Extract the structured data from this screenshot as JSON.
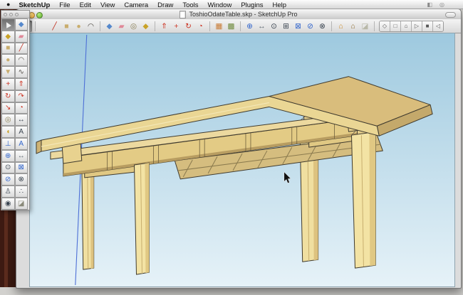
{
  "menubar": {
    "apple_icon": "●",
    "items": [
      "SketchUp",
      "File",
      "Edit",
      "View",
      "Camera",
      "Draw",
      "Tools",
      "Window",
      "Plugins",
      "Help"
    ],
    "extras": [
      {
        "name": "menu-extra-display-icon",
        "glyph": "◧"
      },
      {
        "name": "menu-extra-volume-icon",
        "glyph": "◎"
      }
    ]
  },
  "window": {
    "title": "ToshioOdateTable.skp - SketchUp Pro"
  },
  "toolbar": {
    "groups": [
      [
        {
          "name": "select-tool",
          "glyph": "▶",
          "color": "#1a1a1a",
          "active": true,
          "rotate": true
        }
      ],
      [
        {
          "name": "line-tool",
          "glyph": "╱",
          "color": "#c03020"
        },
        {
          "name": "rectangle-tool",
          "glyph": "■",
          "color": "#c9ad6d"
        },
        {
          "name": "circle-tool",
          "glyph": "●",
          "color": "#c9ad6d"
        },
        {
          "name": "arc-tool",
          "glyph": "◠",
          "color": "#55504a"
        }
      ],
      [
        {
          "name": "make-component-tool",
          "glyph": "◆",
          "color": "#5588cc"
        },
        {
          "name": "eraser-tool",
          "glyph": "▰",
          "color": "#e08898"
        },
        {
          "name": "tape-measure-tool",
          "glyph": "◎",
          "color": "#8a7f55"
        },
        {
          "name": "paint-bucket-tool",
          "glyph": "◆",
          "color": "#c9a227"
        }
      ],
      [
        {
          "name": "push-pull-tool",
          "glyph": "⇑",
          "color": "#cc3322"
        },
        {
          "name": "move-tool",
          "glyph": "+",
          "color": "#cc3322"
        },
        {
          "name": "rotate-tool",
          "glyph": "↻",
          "color": "#cc3322"
        },
        {
          "name": "offset-tool",
          "glyph": "◔",
          "color": "#cc3322"
        }
      ],
      [
        {
          "name": "toggle-terrain-button",
          "glyph": "▦",
          "color": "#c87830"
        },
        {
          "name": "add-location-button",
          "glyph": "▩",
          "color": "#6e8a3c"
        }
      ],
      [
        {
          "name": "orbit-tool",
          "glyph": "⊕",
          "color": "#3366cc"
        },
        {
          "name": "pan-tool",
          "glyph": "↔",
          "color": "#66707a"
        },
        {
          "name": "zoom-tool",
          "glyph": "⊙",
          "color": "#3a4450"
        },
        {
          "name": "zoom-window-tool",
          "glyph": "⊞",
          "color": "#3a4450"
        },
        {
          "name": "zoom-extents-tool",
          "glyph": "⊠",
          "color": "#3366cc"
        },
        {
          "name": "zoom-previous-tool",
          "glyph": "⊘",
          "color": "#3366cc"
        },
        {
          "name": "zoom-next-tool",
          "glyph": "⊗",
          "color": "#3a4450"
        }
      ],
      [
        {
          "name": "get-models-button",
          "glyph": "⌂",
          "color": "#cc8822"
        },
        {
          "name": "share-model-button",
          "glyph": "⌂",
          "color": "#8a6a2c"
        },
        {
          "name": "section-display-button",
          "glyph": "◪",
          "color": "#b9b9a9"
        }
      ]
    ],
    "views": [
      {
        "name": "view-iso-button",
        "glyph": "◇"
      },
      {
        "name": "view-top-button",
        "glyph": "□"
      },
      {
        "name": "view-front-button",
        "glyph": "⌂"
      },
      {
        "name": "view-right-button",
        "glyph": "▷"
      },
      {
        "name": "view-back-button",
        "glyph": "■"
      },
      {
        "name": "view-left-button",
        "glyph": "◁"
      }
    ]
  },
  "palette": {
    "tools": [
      {
        "name": "select-tool",
        "glyph": "▶",
        "color": "#f2f2f2",
        "active": true,
        "rotate": true
      },
      {
        "name": "make-component-tool",
        "glyph": "◆",
        "color": "#5588cc"
      },
      {
        "name": "paint-bucket-tool",
        "glyph": "◆",
        "color": "#c9a227"
      },
      {
        "name": "eraser-tool",
        "glyph": "▰",
        "color": "#e08898"
      },
      {
        "name": "rectangle-tool",
        "glyph": "■",
        "color": "#c9ad6d"
      },
      {
        "name": "line-tool",
        "glyph": "╱",
        "color": "#c03020"
      },
      {
        "name": "circle-tool",
        "glyph": "●",
        "color": "#c9ad6d"
      },
      {
        "name": "arc-tool",
        "glyph": "◠",
        "color": "#55504a"
      },
      {
        "name": "polygon-tool",
        "glyph": "▼",
        "color": "#c9ad6d"
      },
      {
        "name": "freehand-tool",
        "glyph": "∿",
        "color": "#55504a"
      },
      {
        "name": "move-tool",
        "glyph": "+",
        "color": "#cc3322"
      },
      {
        "name": "push-pull-tool",
        "glyph": "⇑",
        "color": "#cc3322"
      },
      {
        "name": "rotate-tool",
        "glyph": "↻",
        "color": "#cc3322"
      },
      {
        "name": "follow-me-tool",
        "glyph": "↷",
        "color": "#cc3322"
      },
      {
        "name": "scale-tool",
        "glyph": "↘",
        "color": "#cc3322"
      },
      {
        "name": "offset-tool",
        "glyph": "◔",
        "color": "#cc3322"
      },
      {
        "name": "tape-measure-tool",
        "glyph": "◎",
        "color": "#8a7f55"
      },
      {
        "name": "dimension-tool",
        "glyph": "↔",
        "color": "#3a4450"
      },
      {
        "name": "protractor-tool",
        "glyph": "◖",
        "color": "#c9a227"
      },
      {
        "name": "text-tool",
        "glyph": "A",
        "color": "#3a4450"
      },
      {
        "name": "axes-tool",
        "glyph": "⊥",
        "color": "#3366cc"
      },
      {
        "name": "3d-text-tool",
        "glyph": "A",
        "color": "#3366cc"
      },
      {
        "name": "orbit-tool",
        "glyph": "⊕",
        "color": "#3366cc"
      },
      {
        "name": "pan-tool",
        "glyph": "↔",
        "color": "#66707a"
      },
      {
        "name": "zoom-tool",
        "glyph": "⊙",
        "color": "#3a4450"
      },
      {
        "name": "zoom-extents-tool",
        "glyph": "⊠",
        "color": "#3366cc"
      },
      {
        "name": "zoom-previous-tool",
        "glyph": "⊘",
        "color": "#3366cc"
      },
      {
        "name": "zoom-next-tool",
        "glyph": "⊗",
        "color": "#3a4450"
      },
      {
        "name": "position-camera-tool",
        "glyph": "♙",
        "color": "#3a4450"
      },
      {
        "name": "walk-tool",
        "glyph": "∴",
        "color": "#3a4450"
      },
      {
        "name": "look-around-tool",
        "glyph": "◉",
        "color": "#3a4450"
      },
      {
        "name": "section-plane-tool",
        "glyph": "◪",
        "color": "#8a8a7a"
      }
    ]
  },
  "canvas": {
    "model_name": "table-model",
    "colors": {
      "sky_top": "#9ec9df",
      "sky_bottom": "#e6f2f8",
      "wood_top_face": "#d9bd7c",
      "wood_light": "#f3e3a4",
      "wood_mid": "#e3cb85",
      "wood_edge": "#ead694",
      "wood_dark": "#b89d61",
      "outline": "#3f3a2e",
      "axis_blue": "#4d6fd6"
    }
  }
}
